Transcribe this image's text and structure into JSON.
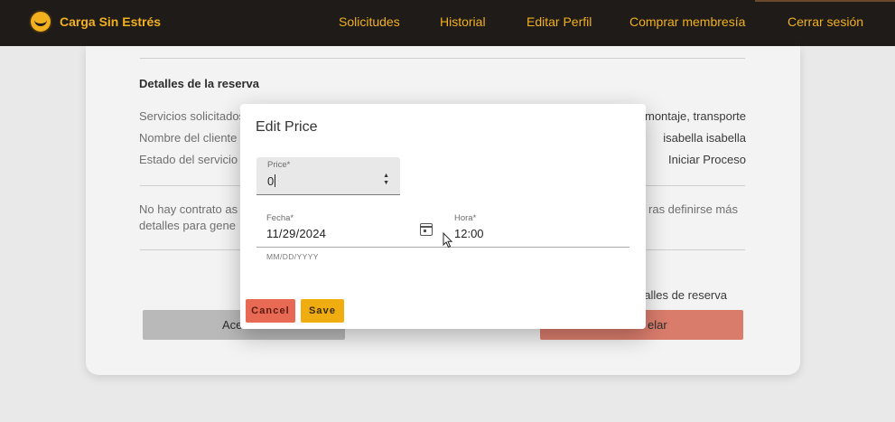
{
  "navbar": {
    "brand": "Carga Sin Estrés",
    "links": [
      "Solicitudes",
      "Historial",
      "Editar Perfil",
      "Comprar membresía",
      "Cerrar sesión"
    ],
    "background": "#1e1b18",
    "accent": "#f2b01e"
  },
  "page": {
    "section_title": "Detalles de la reserva",
    "rows": [
      {
        "label": "Servicios solicitados",
        "value": "montaje, transporte"
      },
      {
        "label": "Nombre del cliente",
        "value": "isabella isabella"
      },
      {
        "label": "Estado del servicio",
        "value": "Iniciar Proceso"
      }
    ],
    "note_left_1": "No hay contrato as",
    "note_left_2": "detalles para gene",
    "note_right_1": "ras definirse más",
    "bottom_right_text": "alles de reserva",
    "accept_partial": "Ace",
    "cancel_partial": "elar"
  },
  "modal": {
    "title": "Edit Price",
    "price": {
      "label": "Price*",
      "value": "0"
    },
    "date": {
      "label": "Fecha*",
      "value": "11/29/2024",
      "hint": "MM/DD/YYYY"
    },
    "time": {
      "label": "Hora*",
      "value": "12:00"
    },
    "cancel_label": "Cancel",
    "save_label": "Save",
    "cancel_color": "#e86a55",
    "save_color": "#efad12"
  }
}
